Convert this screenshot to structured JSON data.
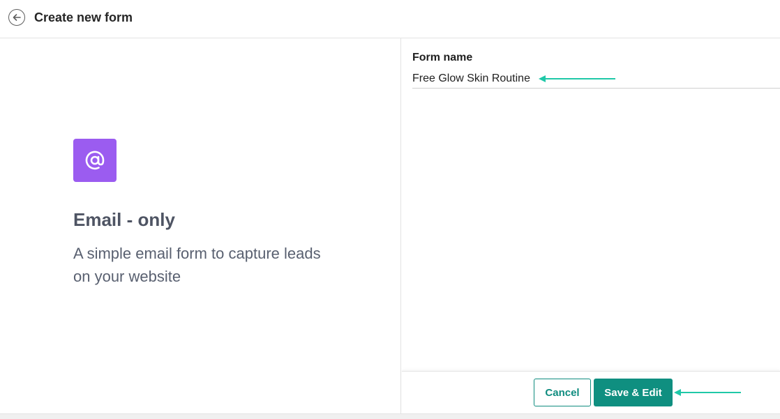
{
  "header": {
    "title": "Create new form",
    "back_icon": "arrow-left-circle-icon"
  },
  "template": {
    "icon": "at-sign-icon",
    "icon_color": "#9b5cf0",
    "title": "Email - only",
    "description": "A simple email form to capture leads on your website"
  },
  "form": {
    "name_label": "Form name",
    "name_value": "Free Glow Skin Routine"
  },
  "footer": {
    "cancel_label": "Cancel",
    "save_label": "Save & Edit"
  },
  "colors": {
    "accent": "#0f8f80",
    "annotation_arrow": "#1fc8a8"
  }
}
